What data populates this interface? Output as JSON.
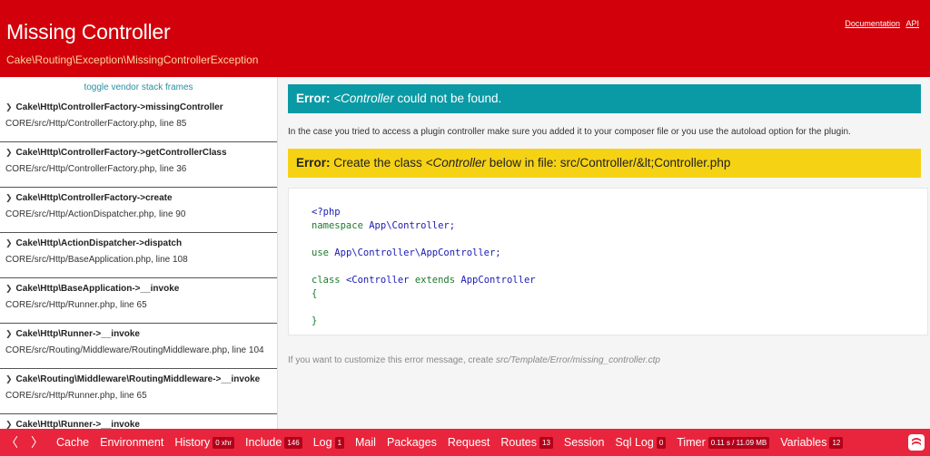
{
  "header": {
    "title": "Missing Controller",
    "subtitle": "Cake\\Routing\\Exception\\MissingControllerException",
    "links": [
      "Documentation",
      "API"
    ]
  },
  "sidebar": {
    "toggle_label": "toggle vendor stack frames",
    "frames": [
      {
        "fn": "Cake\\Http\\ControllerFactory->missingController",
        "loc": "CORE/src/Http/ControllerFactory.php, line 85"
      },
      {
        "fn": "Cake\\Http\\ControllerFactory->getControllerClass",
        "loc": "CORE/src/Http/ControllerFactory.php, line 36"
      },
      {
        "fn": "Cake\\Http\\ControllerFactory->create",
        "loc": "CORE/src/Http/ActionDispatcher.php, line 90"
      },
      {
        "fn": "Cake\\Http\\ActionDispatcher->dispatch",
        "loc": "CORE/src/Http/BaseApplication.php, line 108"
      },
      {
        "fn": "Cake\\Http\\BaseApplication->__invoke",
        "loc": "CORE/src/Http/Runner.php, line 65"
      },
      {
        "fn": "Cake\\Http\\Runner->__invoke",
        "loc": "CORE/src/Routing/Middleware/RoutingMiddleware.php, line 104"
      },
      {
        "fn": "Cake\\Routing\\Middleware\\RoutingMiddleware->__invoke",
        "loc": "CORE/src/Http/Runner.php, line 65"
      },
      {
        "fn": "Cake\\Http\\Runner->__invoke",
        "loc": ""
      }
    ]
  },
  "error": {
    "label": "Error:",
    "class_name": "<Controller",
    "message": " could not be found."
  },
  "hint": "In the case you tried to access a plugin controller make sure you added it to your composer file or you use the autoload option for the plugin.",
  "todo": {
    "label": "Error:",
    "text_before": " Create the class ",
    "class_name": "<Controller",
    "text_after": " below in file: src/Controller/&lt;Controller.php"
  },
  "code": {
    "php_open": "<?php",
    "namespace_kw": "namespace",
    "namespace_val": "App\\Controller;",
    "use_kw": "use",
    "use_val": "App\\Controller\\AppController;",
    "class_kw": "class",
    "class_name": "<Controller",
    "extends_kw": "extends",
    "extends_val": "AppController",
    "open_brace": "{",
    "close_brace": "}"
  },
  "customize": {
    "text": "If you want to customize this error message, create ",
    "path": "src/Template/Error/missing_controller.ctp"
  },
  "toolbar": {
    "prev": "〈",
    "next": "〉",
    "items": [
      {
        "label": "Cache",
        "badge": ""
      },
      {
        "label": "Environment",
        "badge": ""
      },
      {
        "label": "History",
        "badge": "0 xhr"
      },
      {
        "label": "Include",
        "badge": "146"
      },
      {
        "label": "Log",
        "badge": "1"
      },
      {
        "label": "Mail",
        "badge": ""
      },
      {
        "label": "Packages",
        "badge": ""
      },
      {
        "label": "Request",
        "badge": ""
      },
      {
        "label": "Routes",
        "badge": "13"
      },
      {
        "label": "Session",
        "badge": ""
      },
      {
        "label": "Sql Log",
        "badge": "0"
      },
      {
        "label": "Timer",
        "badge": "0.11 s / 11.09 MB"
      },
      {
        "label": "Variables",
        "badge": "12"
      }
    ]
  },
  "colors": {
    "header_bg": "#d1000a",
    "error_banner": "#0a9aa5",
    "todo_banner": "#f6d215",
    "toolbar_bg": "#e8253c"
  }
}
